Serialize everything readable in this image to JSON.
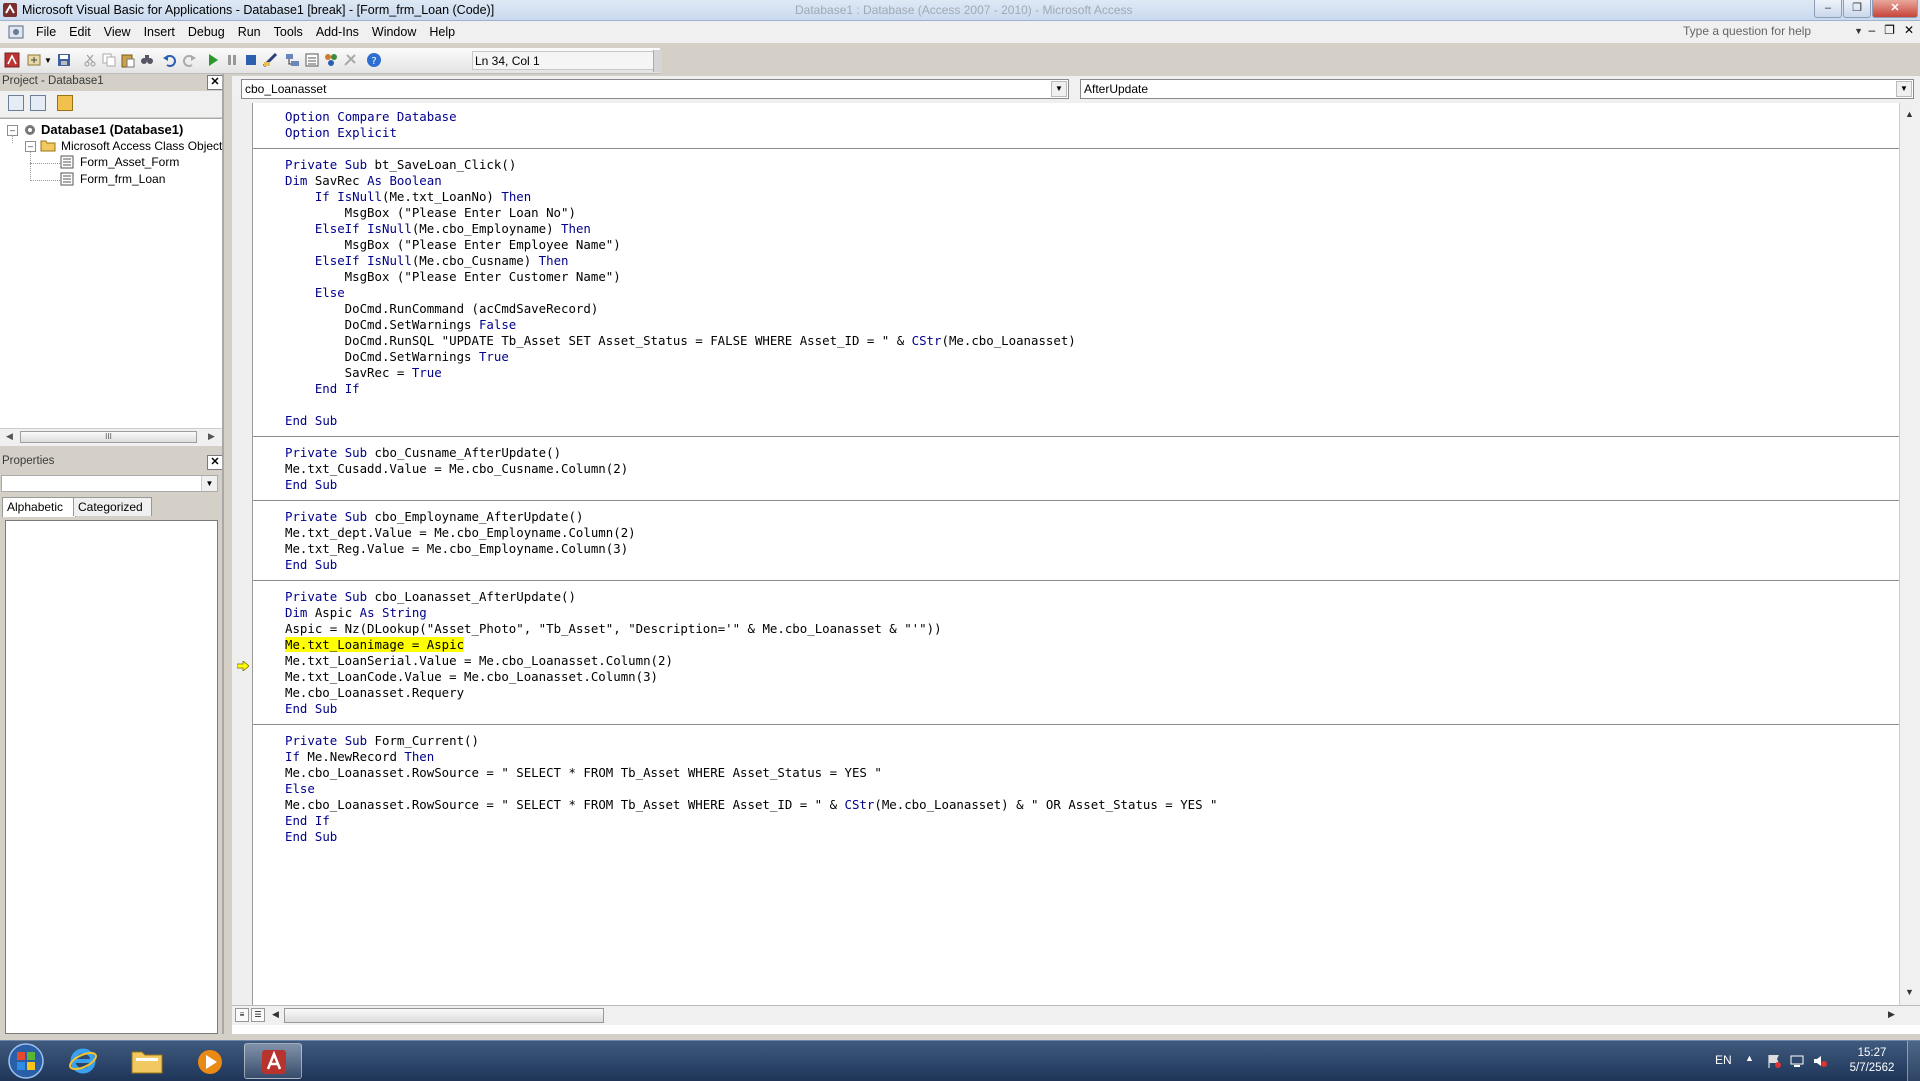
{
  "window": {
    "title": "Microsoft Visual Basic for Applications - Database1 [break] - [Form_frm_Loan (Code)]",
    "host_title_ghost": "Database1 : Database (Access 2007 - 2010) - Microsoft Access"
  },
  "menu": {
    "items": [
      "File",
      "Edit",
      "View",
      "Insert",
      "Debug",
      "Run",
      "Tools",
      "Add-Ins",
      "Window",
      "Help"
    ],
    "help_placeholder": "Type a question for help"
  },
  "toolbar": {
    "position": "Ln 34, Col 1"
  },
  "project": {
    "title": "Project - Database1",
    "tree": [
      {
        "label": "Database1 (Database1)",
        "level": 0,
        "bold": true
      },
      {
        "label": "Microsoft Access Class Object",
        "level": 1,
        "bold": false
      },
      {
        "label": "Form_Asset_Form",
        "level": 2,
        "bold": false
      },
      {
        "label": "Form_frm_Loan",
        "level": 2,
        "bold": false
      }
    ],
    "scroll_thumb_label": "III"
  },
  "properties": {
    "title": "Properties",
    "tabs": [
      "Alphabetic",
      "Categorized"
    ]
  },
  "code_window": {
    "object_combo": "cbo_Loanasset",
    "procedure_combo": "AfterUpdate",
    "highlighted_line": 33,
    "lines": [
      "Option Compare Database",
      "Option Explicit",
      "",
      "Private Sub bt_SaveLoan_Click()",
      "Dim SavRec As Boolean",
      "    If IsNull(Me.txt_LoanNo) Then",
      "        MsgBox (\"Please Enter Loan No\")",
      "    ElseIf IsNull(Me.cbo_Employname) Then",
      "        MsgBox (\"Please Enter Employee Name\")",
      "    ElseIf IsNull(Me.cbo_Cusname) Then",
      "        MsgBox (\"Please Enter Customer Name\")",
      "    Else",
      "        DoCmd.RunCommand (acCmdSaveRecord)",
      "        DoCmd.SetWarnings False",
      "        DoCmd.RunSQL \"UPDATE Tb_Asset SET Asset_Status = FALSE WHERE Asset_ID = \" & CStr(Me.cbo_Loanasset)",
      "        DoCmd.SetWarnings True",
      "        SavRec = True",
      "    End If",
      "",
      "End Sub",
      "",
      "Private Sub cbo_Cusname_AfterUpdate()",
      "Me.txt_Cusadd.Value = Me.cbo_Cusname.Column(2)",
      "End Sub",
      "",
      "Private Sub cbo_Employname_AfterUpdate()",
      "Me.txt_dept.Value = Me.cbo_Employname.Column(2)",
      "Me.txt_Reg.Value = Me.cbo_Employname.Column(3)",
      "End Sub",
      "",
      "Private Sub cbo_Loanasset_AfterUpdate()",
      "Dim Aspic As String",
      "Aspic = Nz(DLookup(\"Asset_Photo\", \"Tb_Asset\", \"Description='\" & Me.cbo_Loanasset & \"'\"))",
      "Me.txt_Loanimage = Aspic",
      "Me.txt_LoanSerial.Value = Me.cbo_Loanasset.Column(2)",
      "Me.txt_LoanCode.Value = Me.cbo_Loanasset.Column(3)",
      "Me.cbo_Loanasset.Requery",
      "End Sub",
      "",
      "Private Sub Form_Current()",
      "If Me.NewRecord Then",
      "Me.cbo_Loanasset.RowSource = \" SELECT * FROM Tb_Asset WHERE Asset_Status = YES \"",
      "Else",
      "Me.cbo_Loanasset.RowSource = \" SELECT * FROM Tb_Asset WHERE Asset_ID = \" & CStr(Me.cbo_Loanasset) & \" OR Asset_Status = YES \"",
      "End If",
      "End Sub"
    ]
  },
  "taskbar": {
    "language": "EN",
    "time": "15:27",
    "date": "5/7/2562",
    "apps": [
      "internet-explorer",
      "file-explorer",
      "media-player",
      "microsoft-access"
    ]
  },
  "colors": {
    "keyword": "#00008b",
    "highlight": "#ffff00",
    "taskbar": "#1e3558"
  }
}
